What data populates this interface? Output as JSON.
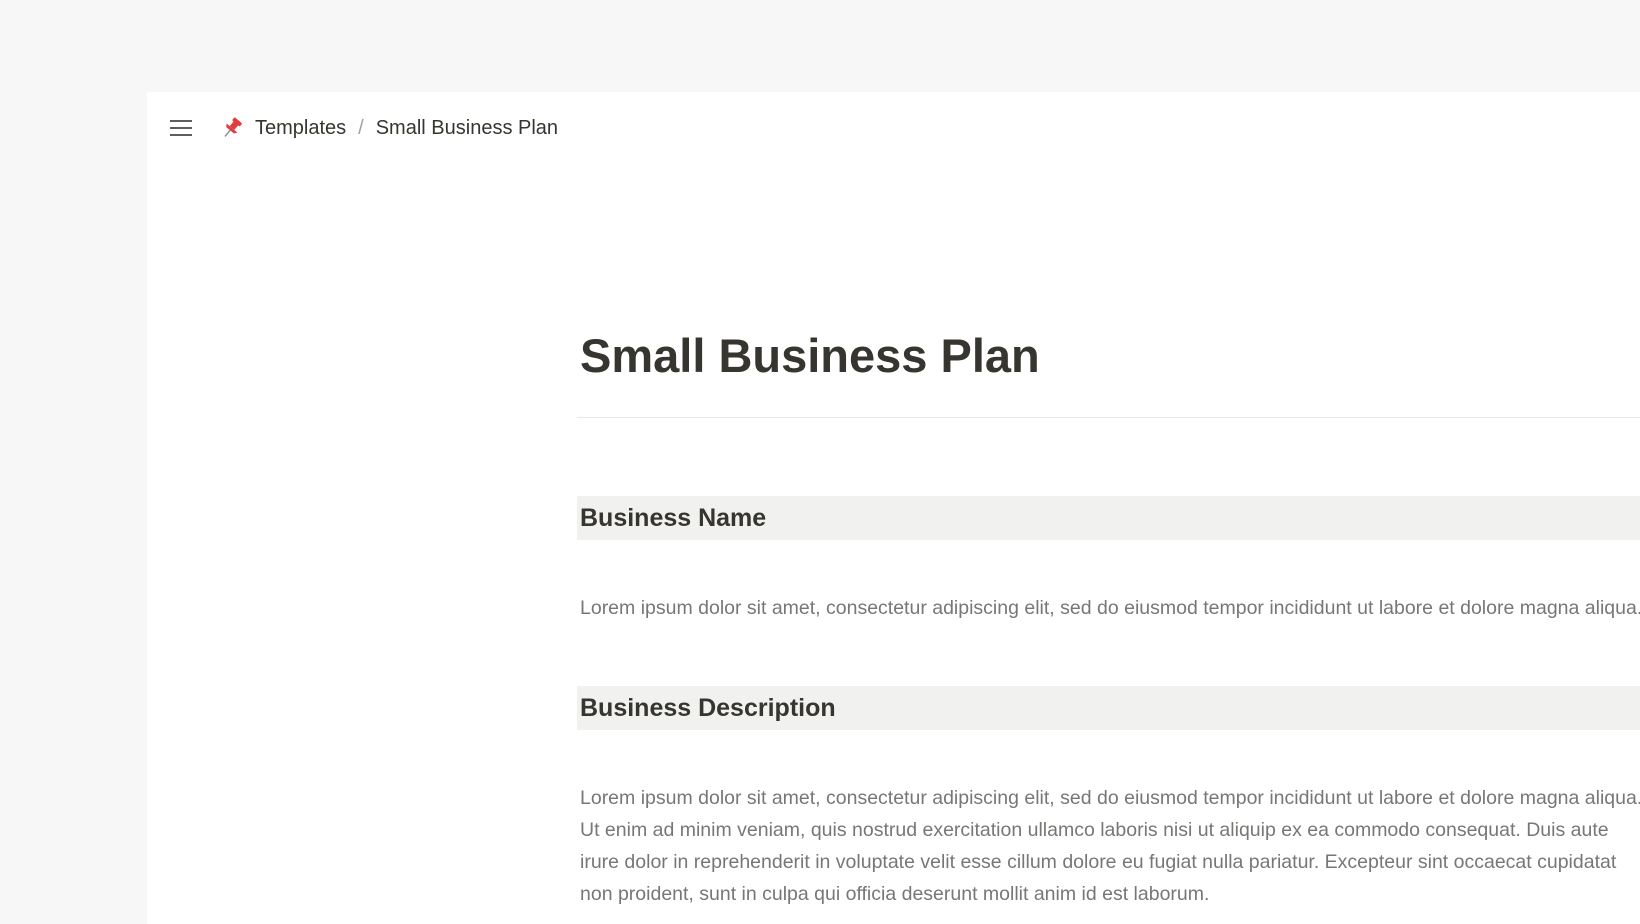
{
  "breadcrumb": {
    "menu_icon": "hamburger-menu-icon",
    "page_icon": "pushpin-icon",
    "items": [
      {
        "label": "Templates"
      },
      {
        "label": "Small Business Plan"
      }
    ],
    "separator": "/"
  },
  "document": {
    "title": "Small Business Plan",
    "sections": [
      {
        "heading": "Business Name",
        "body": "Lorem ipsum dolor sit amet, consectetur adipiscing elit, sed do eiusmod tempor incididunt ut labore et dolore magna aliqua."
      },
      {
        "heading": "Business Description",
        "body": "Lorem ipsum dolor sit amet, consectetur adipiscing elit, sed do eiusmod tempor incididunt ut labore et dolore magna aliqua. Ut enim ad minim veniam, quis nostrud exercitation ullamco laboris nisi ut aliquip ex ea commodo consequat. Duis aute irure dolor in reprehenderit in voluptate velit esse cillum dolore eu fugiat nulla pariatur. Excepteur sint occaecat cupidatat non proident, sunt in culpa qui officia deserunt mollit anim id est laborum."
      }
    ]
  },
  "colors": {
    "app_background": "#f7f7f7",
    "page_background": "#ffffff",
    "text_primary": "#37352f",
    "text_muted": "#787774",
    "heading_background": "#f1f1ef",
    "pin_red": "#e03e3e"
  }
}
